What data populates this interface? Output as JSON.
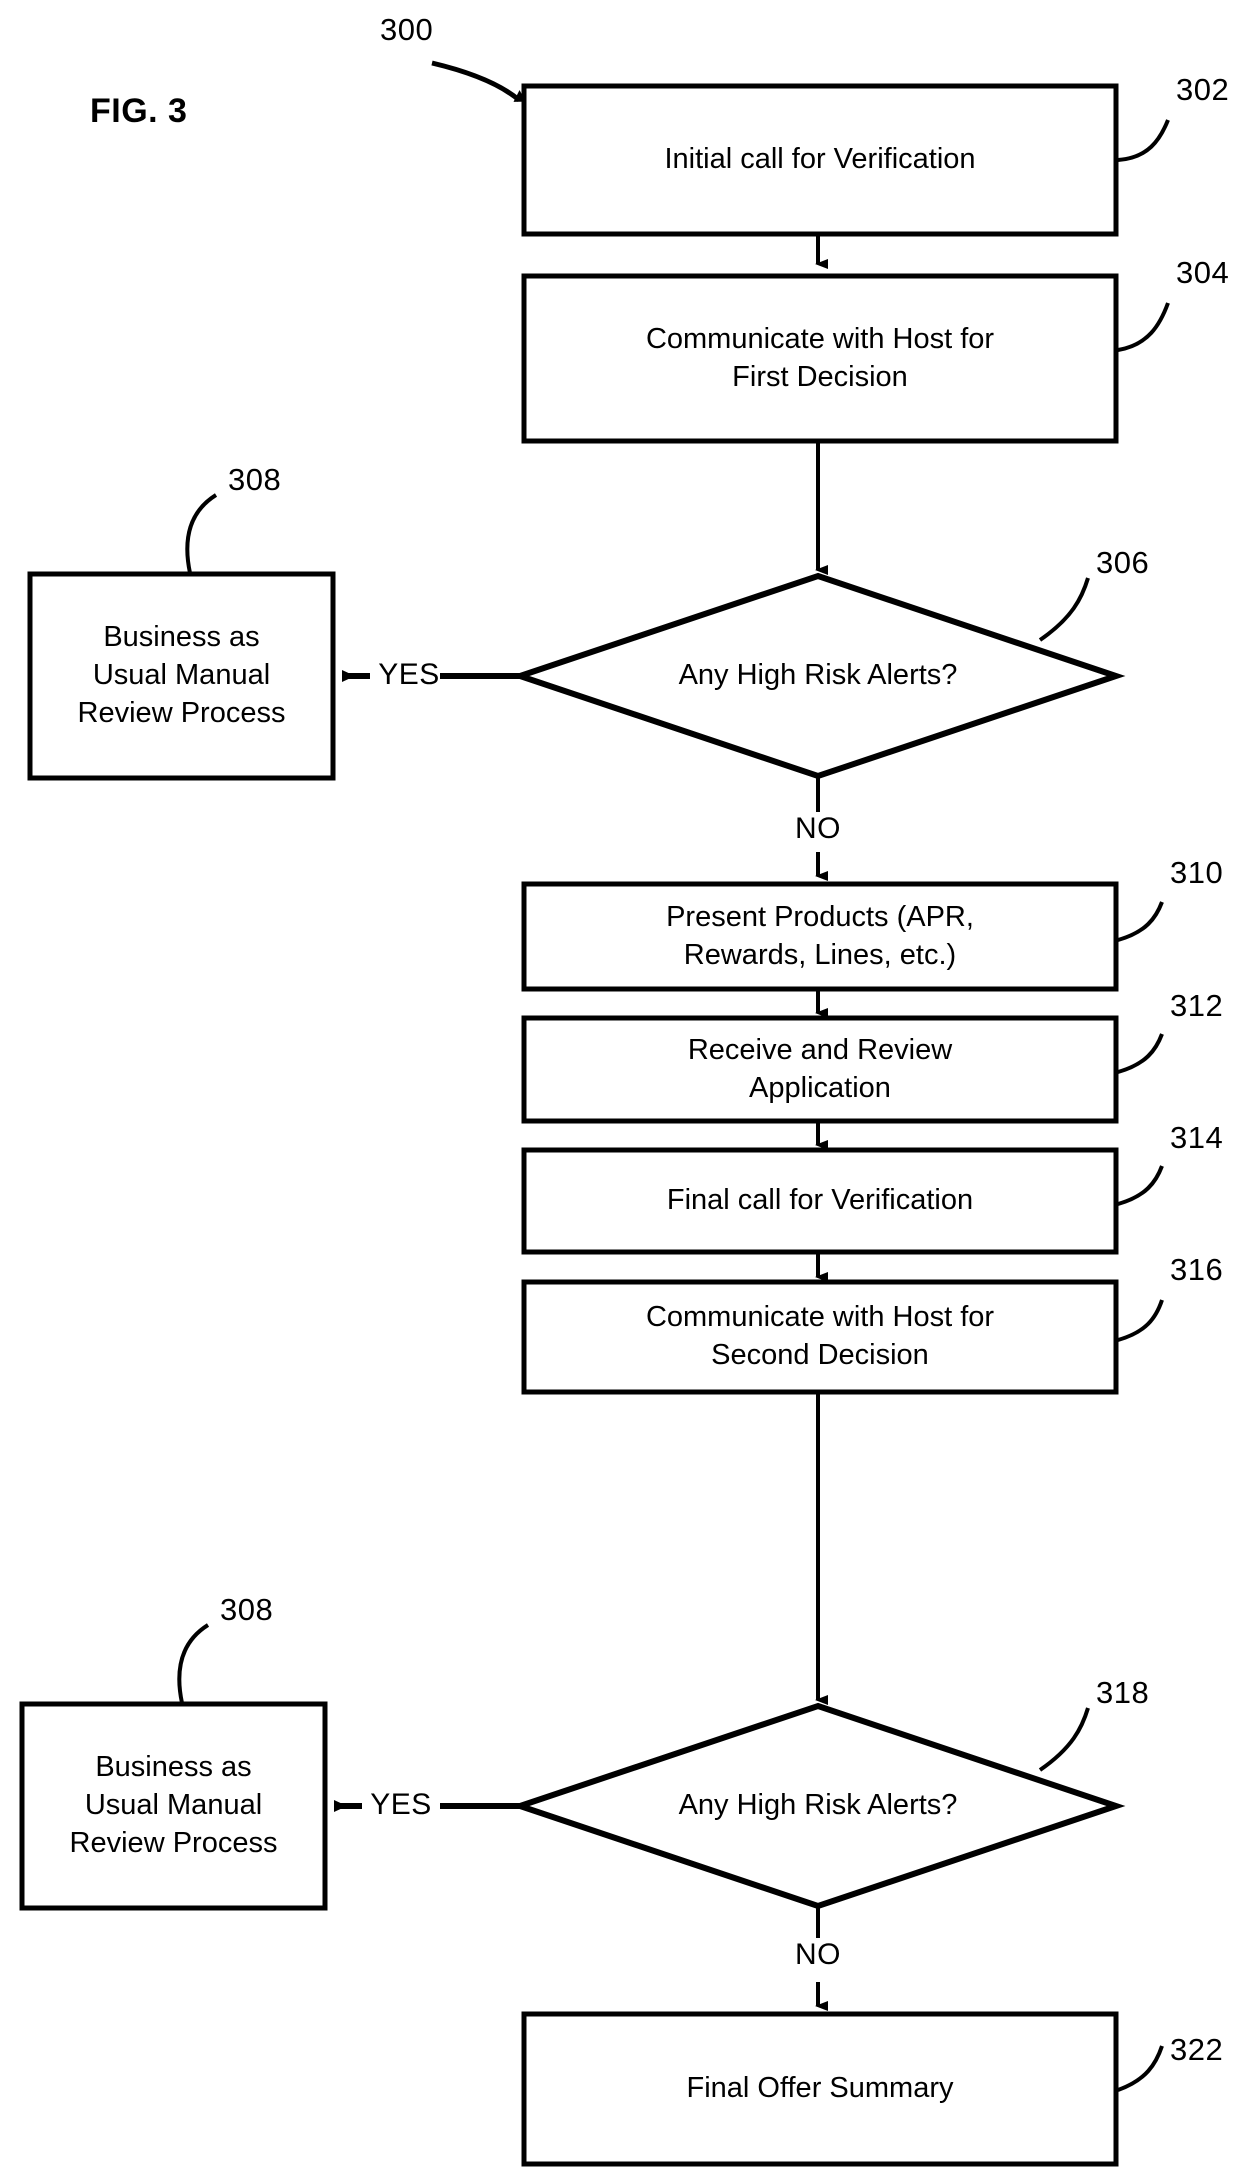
{
  "figure": {
    "label": "FIG. 3",
    "diagram_ref": "300"
  },
  "nodes": [
    {
      "id": "initial-call",
      "ref": "302",
      "shape": "process",
      "lines": [
        "Initial call for Verification"
      ]
    },
    {
      "id": "communicate-first",
      "ref": "304",
      "shape": "process",
      "lines": [
        "Communicate with Host for",
        "First Decision"
      ]
    },
    {
      "id": "risk-check-first",
      "ref": "306",
      "shape": "decision",
      "lines": [
        "Any High Risk Alerts?"
      ]
    },
    {
      "id": "manual-review-first",
      "ref": "308",
      "shape": "process",
      "lines": [
        "Business as",
        "Usual Manual",
        "Review Process"
      ]
    },
    {
      "id": "present-products",
      "ref": "310",
      "shape": "process",
      "lines": [
        "Present Products (APR,",
        "Rewards, Lines, etc.)"
      ]
    },
    {
      "id": "receive-review",
      "ref": "312",
      "shape": "process",
      "lines": [
        "Receive and Review",
        "Application"
      ]
    },
    {
      "id": "final-call",
      "ref": "314",
      "shape": "process",
      "lines": [
        "Final call for Verification"
      ]
    },
    {
      "id": "communicate-second",
      "ref": "316",
      "shape": "process",
      "lines": [
        "Communicate with Host for",
        "Second Decision"
      ]
    },
    {
      "id": "risk-check-second",
      "ref": "318",
      "shape": "decision",
      "lines": [
        "Any High Risk Alerts?"
      ]
    },
    {
      "id": "manual-review-second",
      "ref": "308",
      "shape": "process",
      "lines": [
        "Business as",
        "Usual Manual",
        "Review Process"
      ]
    },
    {
      "id": "final-offer",
      "ref": "322",
      "shape": "process",
      "lines": [
        "Final Offer Summary"
      ]
    }
  ],
  "edge_labels": {
    "yes_first": "YES",
    "no_first": "NO",
    "yes_second": "YES",
    "no_second": "NO"
  },
  "colors": {
    "stroke": "#000000",
    "fill": "#ffffff",
    "text": "#000000"
  }
}
